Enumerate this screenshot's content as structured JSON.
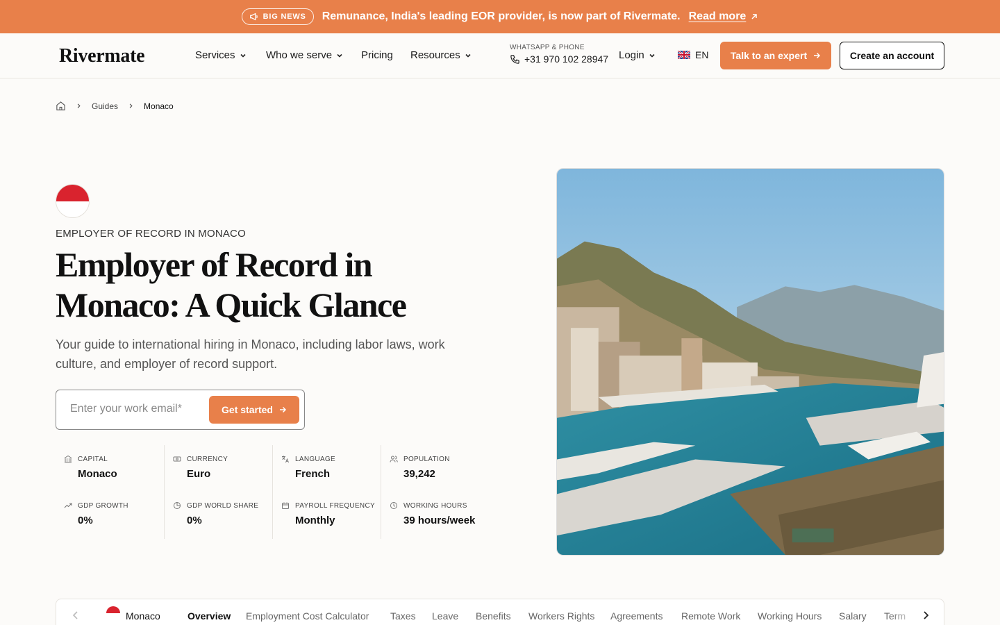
{
  "announcement": {
    "badge": "BIG NEWS",
    "text": "Remunance, India's leading EOR provider, is now part of Rivermate.",
    "link": "Read more"
  },
  "header": {
    "logo": "Rivermate",
    "nav": {
      "services": "Services",
      "who_we_serve": "Who we serve",
      "pricing": "Pricing",
      "resources": "Resources"
    },
    "phone_label": "WHATSAPP & PHONE",
    "phone_number": "+31 970 102 28947",
    "login": "Login",
    "language": "EN",
    "cta_expert": "Talk to an expert",
    "cta_account": "Create an account"
  },
  "breadcrumb": {
    "guides": "Guides",
    "current": "Monaco"
  },
  "hero": {
    "eyebrow": "EMPLOYER OF RECORD IN MONACO",
    "title": "Employer of Record in Monaco: A Quick Glance",
    "subtitle": "Your guide to international hiring in Monaco, including labor laws, work culture, and employer of record support.",
    "email_placeholder": "Enter your work email*",
    "cta": "Get started"
  },
  "stats": {
    "capital": {
      "label": "CAPITAL",
      "value": "Monaco",
      "icon": "bank-icon"
    },
    "currency": {
      "label": "CURRENCY",
      "value": "Euro",
      "icon": "money-icon"
    },
    "language": {
      "label": "LANGUAGE",
      "value": "French",
      "icon": "translate-icon"
    },
    "population": {
      "label": "POPULATION",
      "value": "39,242",
      "icon": "people-icon"
    },
    "gdp_growth": {
      "label": "GDP GROWTH",
      "value": "0%",
      "icon": "trend-up-icon"
    },
    "gdp_share": {
      "label": "GDP WORLD SHARE",
      "value": "0%",
      "icon": "pie-icon"
    },
    "payroll": {
      "label": "PAYROLL FREQUENCY",
      "value": "Monthly",
      "icon": "calendar-icon"
    },
    "hours": {
      "label": "WORKING HOURS",
      "value": "39 hours/week",
      "icon": "clock-icon"
    }
  },
  "tabs": {
    "country": "Monaco",
    "items": [
      "Overview",
      "Employment Cost Calculator",
      "Taxes",
      "Leave",
      "Benefits",
      "Workers Rights",
      "Agreements",
      "Remote Work",
      "Working Hours",
      "Salary",
      "Term"
    ]
  },
  "colors": {
    "accent": "#e8804a",
    "monaco_red": "#d9232e"
  }
}
